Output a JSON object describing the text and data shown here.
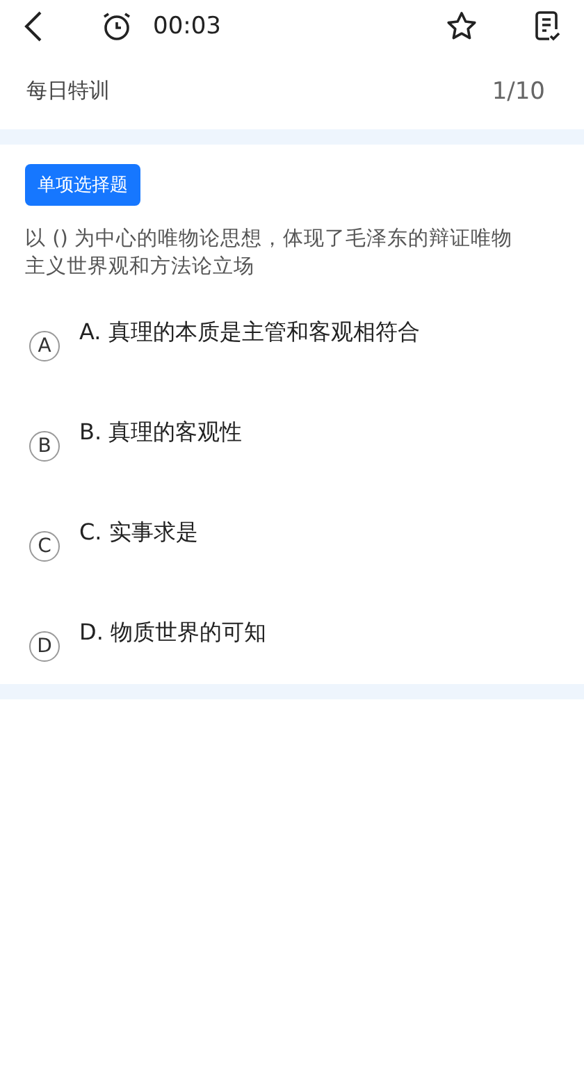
{
  "toolbar": {
    "timer": "00:03"
  },
  "section": {
    "title": "每日特训",
    "progress": "1/10"
  },
  "question": {
    "type_tag": "单项选择题",
    "text": "以 () 为中心的唯物论思想，体现了毛泽东的辩证唯物主义世界观和方法论立场",
    "options": [
      {
        "letter": "A",
        "text": "A. 真理的本质是主管和客观相符合"
      },
      {
        "letter": "B",
        "text": "B. 真理的客观性"
      },
      {
        "letter": "C",
        "text": "C. 实事求是"
      },
      {
        "letter": "D",
        "text": "D. 物质世界的可知"
      }
    ]
  }
}
